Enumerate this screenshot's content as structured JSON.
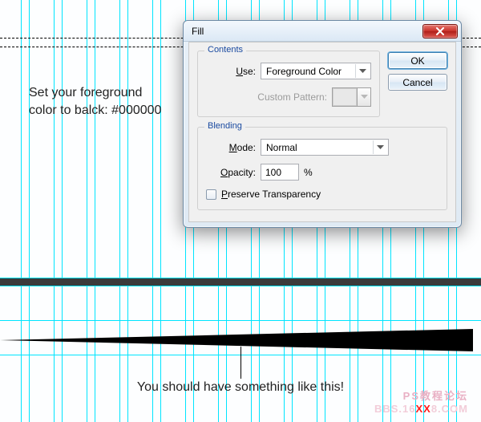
{
  "annotations": {
    "set_fg": "Set your foreground color to balck: #000000",
    "result": "You should have something like this!"
  },
  "dialog": {
    "title": "Fill",
    "ok": "OK",
    "cancel": "Cancel",
    "contents": {
      "legend": "Contents",
      "use_label_pre": "",
      "use_u": "U",
      "use_label_post": "se:",
      "use_value": "Foreground Color",
      "pattern_label": "Custom Pattern:"
    },
    "blending": {
      "legend": "Blending",
      "mode_u": "M",
      "mode_label_post": "ode:",
      "mode_value": "Normal",
      "opacity_u": "O",
      "opacity_label_post": "pacity:",
      "opacity_value": "100",
      "percent": "%",
      "preserve_u": "P",
      "preserve_label_post": "reserve Transparency"
    }
  },
  "watermark": {
    "line1": "PS教程论坛",
    "line2a": "BBS.16",
    "line2b": "XX",
    "line2c": "8.COM"
  },
  "guides": {
    "top_pair": 346,
    "bottom_pair": 356,
    "mid_a": 399,
    "mid_b": 442
  }
}
